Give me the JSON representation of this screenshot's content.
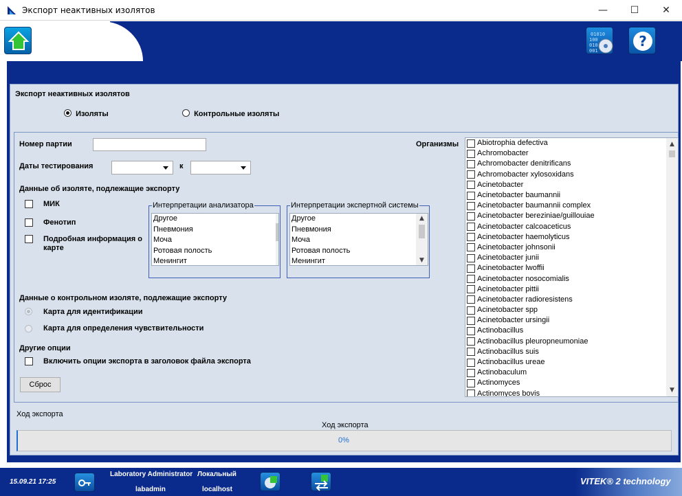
{
  "window": {
    "title": "Экспорт неактивных изолятов",
    "controls": [
      "—",
      "☐",
      "✕"
    ]
  },
  "section": {
    "title": "Экспорт неактивных изолятов",
    "radio_isolates": "Изоляты",
    "radio_control_isolates": "Контрольные изоляты",
    "selected": "isolates"
  },
  "form": {
    "batch_label": "Номер партии",
    "batch_value": "",
    "dates_label": "Даты тестирования",
    "date_from": "",
    "to_label": "к",
    "date_to": "",
    "isolate_data_title": "Данные об изоляте, подлежащие экспорту",
    "checkbox_mic": "МИК",
    "checkbox_phenotype": "Фенотип",
    "checkbox_card_details": "Подробная информация о карте"
  },
  "analyzer_interpretations": {
    "legend": "Интерпретации анализатора",
    "items": [
      "Другое",
      "Пневмония",
      "Моча",
      "Ротовая полость",
      "Менингит"
    ]
  },
  "expert_interpretations": {
    "legend": "Интерпретации экспертной системы",
    "items": [
      "Другое",
      "Пневмония",
      "Моча",
      "Ротовая полость",
      "Менингит"
    ]
  },
  "control_isolate": {
    "title": "Данные о контрольном изоляте, подлежащие экспорту",
    "radio_id_card": "Карта для идентификации",
    "radio_ast_card": "Карта для определения чувствительности"
  },
  "other_options": {
    "title": "Другие опции",
    "include_export_options": "Включить опции экспорта в заголовок файла экспорта"
  },
  "reset_button": "Сброс",
  "organisms": {
    "label": "Организмы",
    "items": [
      "Abiotrophia defectiva",
      "Achromobacter",
      "Achromobacter denitrificans",
      "Achromobacter xylosoxidans",
      "Acinetobacter",
      "Acinetobacter baumannii",
      "Acinetobacter baumannii complex",
      "Acinetobacter bereziniae/guillouiae",
      "Acinetobacter calcoaceticus",
      "Acinetobacter haemolyticus",
      "Acinetobacter johnsonii",
      "Acinetobacter junii",
      "Acinetobacter lwoffii",
      "Acinetobacter nosocomialis",
      "Acinetobacter pittii",
      "Acinetobacter radioresistens",
      "Acinetobacter spp",
      "Acinetobacter ursingii",
      "Actinobacillus",
      "Actinobacillus pleuropneumoniae",
      "Actinobacillus suis",
      "Actinobacillus ureae",
      "Actinobaculum",
      "Actinomyces",
      "Actinomyces bovis"
    ]
  },
  "progress": {
    "label": "Ход экспорта",
    "bar_caption": "Ход экспорта",
    "percent_text": "0%",
    "fraction": 0
  },
  "footer": {
    "datetime": "15.09.21 17:25",
    "user_role": "Laboratory Administrator",
    "username": "labadmin",
    "location_label": "Локальный",
    "host": "localhost",
    "brand": "VITEK® 2 technology"
  },
  "colors": {
    "header_blue": "#0a2a8c",
    "panel_bg": "#d8e1ec",
    "progress_text": "#1f6fd1"
  }
}
